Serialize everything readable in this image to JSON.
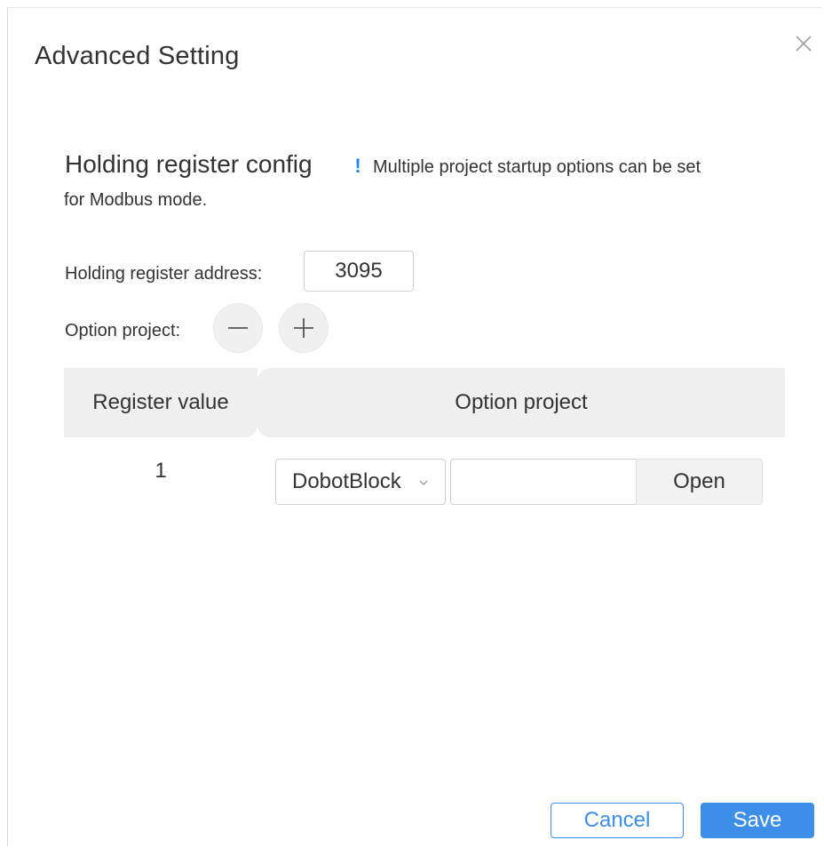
{
  "dialog": {
    "title": "Advanced Setting"
  },
  "section": {
    "title": "Holding register config",
    "hint_line1": "Multiple project startup options can be set",
    "hint_line2": "for Modbus mode."
  },
  "form": {
    "address_label": "Holding register address:",
    "address_value": "3095",
    "option_label": "Option project:"
  },
  "table": {
    "columns": [
      "Register value",
      "Option project"
    ],
    "rows": [
      {
        "register_value": "1",
        "project_type": "DobotBlock",
        "project_path": "",
        "open_label": "Open"
      }
    ]
  },
  "footer": {
    "cancel_label": "Cancel",
    "save_label": "Save"
  },
  "colors": {
    "accent": "#3c8ee8",
    "info": "#1e88e5",
    "header_bg": "#efefef"
  },
  "icons": {
    "close": "close-icon",
    "info": "info-icon",
    "minus": "minus-icon",
    "plus": "plus-icon",
    "chevron": "chevron-down-icon"
  }
}
